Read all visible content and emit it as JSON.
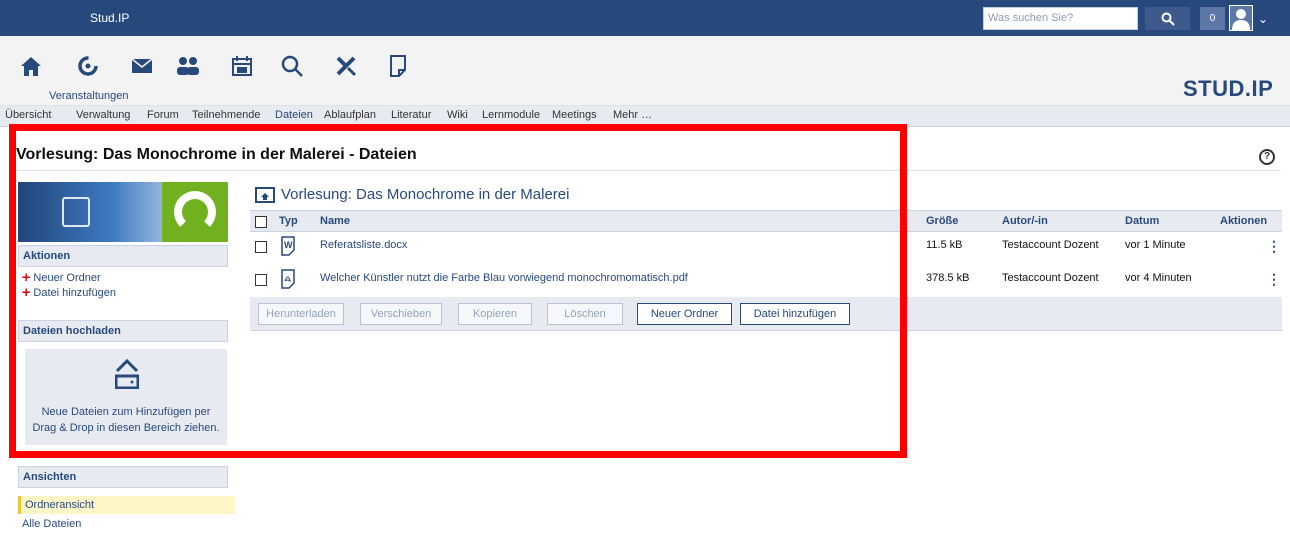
{
  "topbar": {
    "brand": "Stud.IP",
    "search_placeholder": "Was suchen Sie?",
    "notification_count": "0"
  },
  "nav": {
    "active_label": "Veranstaltungen",
    "logo_text": "STUD.IP",
    "icons": [
      "home-icon",
      "courses-icon",
      "messages-icon",
      "community-icon",
      "calendar-icon",
      "search-icon",
      "tools-icon",
      "files-icon"
    ]
  },
  "tabs": [
    {
      "label": "Übersicht",
      "active": false
    },
    {
      "label": "Verwaltung",
      "active": false
    },
    {
      "label": "Forum",
      "active": false
    },
    {
      "label": "Teilnehmende",
      "active": false
    },
    {
      "label": "Dateien",
      "active": true
    },
    {
      "label": "Ablaufplan",
      "active": false
    },
    {
      "label": "Literatur",
      "active": false
    },
    {
      "label": "Wiki",
      "active": false
    },
    {
      "label": "Lernmodule",
      "active": false
    },
    {
      "label": "Meetings",
      "active": false
    },
    {
      "label": "Mehr …",
      "active": false
    }
  ],
  "page": {
    "title": "Vorlesung: Das Monochrome in der Malerei - Dateien"
  },
  "sidebar": {
    "actions_title": "Aktionen",
    "actions": [
      "Neuer Ordner",
      "Datei hinzufügen"
    ],
    "upload_title": "Dateien hochladen",
    "upload_text_1": "Neue Dateien zum Hinzufügen per",
    "upload_text_2": "Drag & Drop in diesen Bereich ziehen.",
    "views_title": "Ansichten",
    "views": [
      {
        "label": "Ordneransicht",
        "active": true
      },
      {
        "label": "Alle Dateien",
        "active": false
      }
    ]
  },
  "files": {
    "folder_title": "Vorlesung: Das Monochrome in der Malerei",
    "columns": {
      "type": "Typ",
      "name": "Name",
      "size": "Größe",
      "author": "Autor/-in",
      "date": "Datum",
      "actions": "Aktionen"
    },
    "rows": [
      {
        "icon": "word-document-icon",
        "name": "Referatsliste.docx",
        "size": "11.5 kB",
        "author": "Testaccount Dozent",
        "date": "vor 1 Minute"
      },
      {
        "icon": "pdf-document-icon",
        "name": "Welcher Künstler nutzt die Farbe Blau vorwiegend monochromomatisch.pdf",
        "size": "378.5 kB",
        "author": "Testaccount Dozent",
        "date": "vor 4 Minuten"
      }
    ],
    "buttons": {
      "download": "Herunterladen",
      "move": "Verschieben",
      "copy": "Kopieren",
      "delete": "Löschen",
      "new_folder": "Neuer Ordner",
      "add_file": "Datei hinzufügen"
    }
  },
  "colors": {
    "brand_blue": "#28497c",
    "light_panel": "#e7ebf1",
    "highlight_red": "#ff0000",
    "logo_green": "#71b01e",
    "active_view": "#fff6c8"
  }
}
